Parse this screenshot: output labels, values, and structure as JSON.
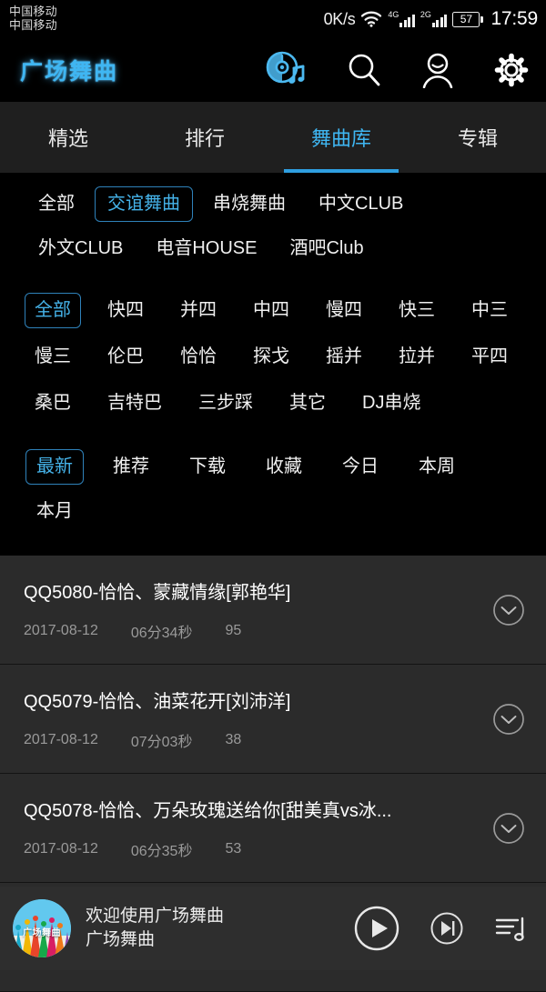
{
  "status_bar": {
    "carrier_1": "中国移动",
    "carrier_2": "中国移动",
    "net_speed": "0K/s",
    "wifi_icon": "wifi-icon",
    "signal_1_label": "4G",
    "signal_2_label": "2G",
    "battery_level": "57",
    "time": "17:59"
  },
  "header": {
    "title": "广场舞曲",
    "icons": [
      {
        "name": "disc-music-icon"
      },
      {
        "name": "search-icon"
      },
      {
        "name": "user-icon"
      },
      {
        "name": "gear-icon"
      }
    ],
    "accent_color": "#3fb6f2"
  },
  "tabs": [
    {
      "label": "精选",
      "active": false
    },
    {
      "label": "排行",
      "active": false
    },
    {
      "label": "舞曲库",
      "active": true
    },
    {
      "label": "专辑",
      "active": false
    }
  ],
  "filters": {
    "genre": {
      "row1": [
        {
          "label": "全部",
          "selected": false
        },
        {
          "label": "交谊舞曲",
          "selected": true
        },
        {
          "label": "串烧舞曲",
          "selected": false
        },
        {
          "label": "中文CLUB",
          "selected": false
        }
      ],
      "row2": [
        {
          "label": "外文CLUB",
          "selected": false
        },
        {
          "label": "电音HOUSE",
          "selected": false
        },
        {
          "label": "酒吧Club",
          "selected": false
        }
      ]
    },
    "style": {
      "row1": [
        {
          "label": "全部",
          "selected": true
        },
        {
          "label": "快四",
          "selected": false
        },
        {
          "label": "并四",
          "selected": false
        },
        {
          "label": "中四",
          "selected": false
        },
        {
          "label": "慢四",
          "selected": false
        },
        {
          "label": "快三",
          "selected": false
        },
        {
          "label": "中三",
          "selected": false
        }
      ],
      "row2": [
        {
          "label": "慢三",
          "selected": false
        },
        {
          "label": "伦巴",
          "selected": false
        },
        {
          "label": "恰恰",
          "selected": false
        },
        {
          "label": "探戈",
          "selected": false
        },
        {
          "label": "摇并",
          "selected": false
        },
        {
          "label": "拉并",
          "selected": false
        },
        {
          "label": "平四",
          "selected": false
        }
      ],
      "row3": [
        {
          "label": "桑巴",
          "selected": false
        },
        {
          "label": "吉特巴",
          "selected": false
        },
        {
          "label": "三步踩",
          "selected": false
        },
        {
          "label": "其它",
          "selected": false
        },
        {
          "label": "DJ串烧",
          "selected": false
        }
      ]
    },
    "sort": [
      {
        "label": "最新",
        "selected": true
      },
      {
        "label": "推荐",
        "selected": false
      },
      {
        "label": "下载",
        "selected": false
      },
      {
        "label": "收藏",
        "selected": false
      },
      {
        "label": "今日",
        "selected": false
      },
      {
        "label": "本周",
        "selected": false
      },
      {
        "label": "本月",
        "selected": false
      }
    ]
  },
  "songs": [
    {
      "title": "QQ5080-恰恰、蒙藏情缘[郭艳华]",
      "date": "2017-08-12",
      "duration": "06分34秒",
      "count": "95",
      "action_icon": "download-circle-icon"
    },
    {
      "title": "QQ5079-恰恰、油菜花开[刘沛洋]",
      "date": "2017-08-12",
      "duration": "07分03秒",
      "count": "38",
      "action_icon": "download-circle-icon"
    },
    {
      "title": "QQ5078-恰恰、万朵玫瑰送给你[甜美真vs冰...",
      "date": "2017-08-12",
      "duration": "06分35秒",
      "count": "53",
      "action_icon": "download-circle-icon"
    }
  ],
  "player": {
    "artwork_label": "广场舞曲",
    "line1": "欢迎使用广场舞曲",
    "line2": "广场舞曲",
    "play_icon": "play-circle-icon",
    "next_icon": "next-track-circle-icon",
    "playlist_icon": "playlist-note-icon"
  }
}
